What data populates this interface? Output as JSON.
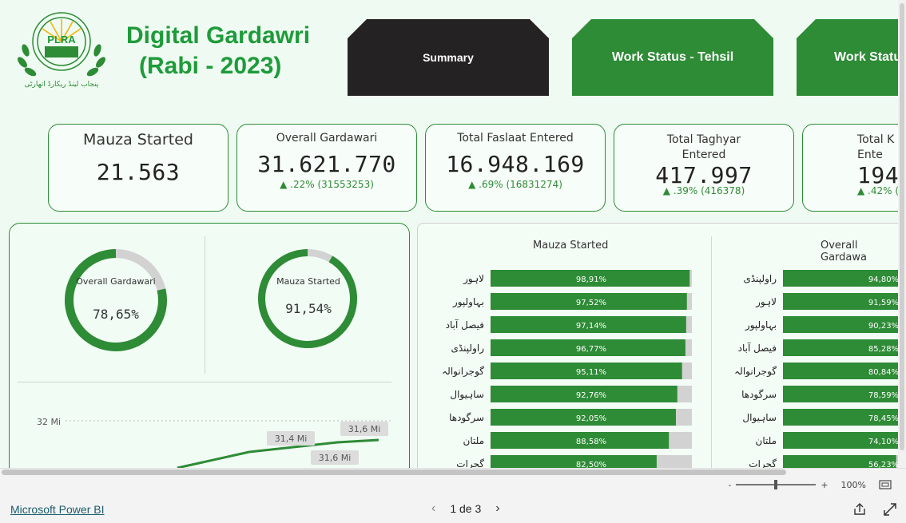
{
  "header": {
    "title_line1": "Digital Gardawri",
    "title_line2": "(Rabi - 2023)",
    "logo_text": "PLRA",
    "logo_caption": "پنجاب لینڈ ریکارڈ اتھارٹی"
  },
  "nav": {
    "summary": "Summary",
    "work_status_tehsil": "Work Status - Tehsil",
    "work_status_cut": "Work Statu"
  },
  "kpis": [
    {
      "title": "Mauza Started",
      "value": "21.563",
      "delta": ""
    },
    {
      "title": "Overall Gardawari",
      "value": "31.621.770",
      "delta": "▲ .22% (31553253)"
    },
    {
      "title": "Total Faslaat Entered",
      "value": "16.948.169",
      "delta": "▲ .69% (16831274)"
    },
    {
      "title": "Total Taghyar\nEntered",
      "value": "417.997",
      "delta": "▲ .39% (416378)"
    },
    {
      "title": "Total K\nEnte",
      "value": "194",
      "delta": "▲ .42% ("
    }
  ],
  "donuts": [
    {
      "label": "Overall Gardawari",
      "value_text": "78,65%",
      "value": 78.65
    },
    {
      "label": "Mauza Started",
      "value_text": "91,54%",
      "value": 91.54
    }
  ],
  "line_chart": {
    "y_tick": "32 Mi",
    "labels": [
      "31,4 Mi",
      "31,6 Mi",
      "31,6 Mi"
    ]
  },
  "chart_data": [
    {
      "type": "bar",
      "title": "Mauza Started",
      "categories": [
        "لاہور",
        "بہاولپور",
        "فیصل آباد",
        "راولپنڈی",
        "گوجرانوالہ",
        "ساہیوال",
        "سرگودھا",
        "ملتان",
        "گجرات"
      ],
      "values": [
        98.91,
        97.52,
        97.14,
        96.77,
        95.11,
        92.76,
        92.05,
        88.58,
        82.5
      ],
      "labels": [
        "98,91%",
        "97,52%",
        "97,14%",
        "96,77%",
        "95,11%",
        "92,76%",
        "92,05%",
        "88,58%",
        "82,50%"
      ],
      "xlim": [
        0,
        100
      ]
    },
    {
      "type": "bar",
      "title": "Overall Gardawa",
      "categories": [
        "راولپنڈی",
        "لاہور",
        "بہاولپور",
        "فیصل آباد",
        "گوجرانوالہ",
        "سرگودھا",
        "ساہیوال",
        "ملتان",
        "گجرات"
      ],
      "values": [
        94.8,
        91.59,
        90.23,
        85.28,
        80.84,
        78.59,
        78.45,
        74.1,
        56.23
      ],
      "labels": [
        "94,80%",
        "91,59%",
        "90,23%",
        "85,28%",
        "80,84%",
        "78,59%",
        "78,45%",
        "74,10%",
        "56,23%"
      ],
      "xlim": [
        0,
        100
      ]
    }
  ],
  "footer": {
    "powerbi": "Microsoft Power BI",
    "page": "1 de 3",
    "zoom": "100%",
    "zoom_minus": "-",
    "zoom_plus": "+"
  },
  "colors": {
    "accent": "#2e8b36",
    "title": "#1e9b3a",
    "dark_button": "#252223",
    "track": "#d2d2d2"
  }
}
